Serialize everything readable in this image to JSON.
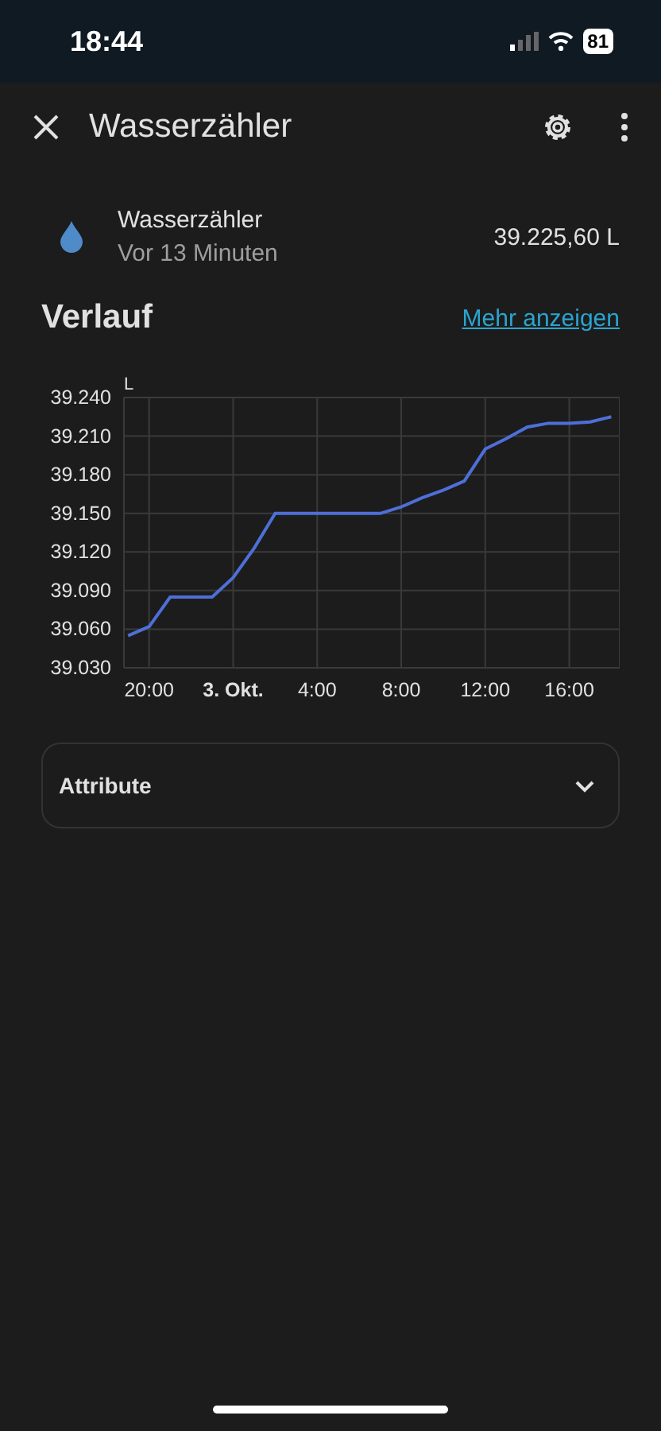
{
  "status_bar": {
    "time": "18:44",
    "battery": "81"
  },
  "header": {
    "title": "Wasserzähler"
  },
  "entity": {
    "name": "Wasserzähler",
    "updated": "Vor 13 Minuten",
    "value": "39.225,60 L"
  },
  "history": {
    "title": "Verlauf",
    "link": "Mehr anzeigen",
    "unit": "L",
    "chart_data": {
      "type": "line",
      "grid": true,
      "ylim": [
        39030,
        39240
      ],
      "categories": [
        null,
        "20:00",
        null,
        null,
        null,
        "3. Okt.",
        null,
        null,
        null,
        "4:00",
        null,
        null,
        null,
        "8:00",
        null,
        null,
        null,
        "12:00",
        null,
        null,
        null,
        "16:00",
        null,
        null
      ],
      "yticks": [
        {
          "value": 39030,
          "label": "39.030"
        },
        {
          "value": 39060,
          "label": "39.060"
        },
        {
          "value": 39090,
          "label": "39.090"
        },
        {
          "value": 39120,
          "label": "39.120"
        },
        {
          "value": 39150,
          "label": "39.150"
        },
        {
          "value": 39180,
          "label": "39.180"
        },
        {
          "value": 39210,
          "label": "39.210"
        },
        {
          "value": 39240,
          "label": "39.240"
        }
      ],
      "series": [
        {
          "color": "#4e6fd8",
          "values": [
            39055,
            39062,
            39085,
            39085,
            39085,
            39100,
            39123,
            39150,
            39150,
            39150,
            39150,
            39150,
            39150,
            39155,
            39162,
            39168,
            39175,
            39200,
            39208,
            39217,
            39220,
            39220,
            39221,
            39225
          ]
        }
      ]
    }
  },
  "attributes": {
    "label": "Attribute",
    "expanded": false
  }
}
